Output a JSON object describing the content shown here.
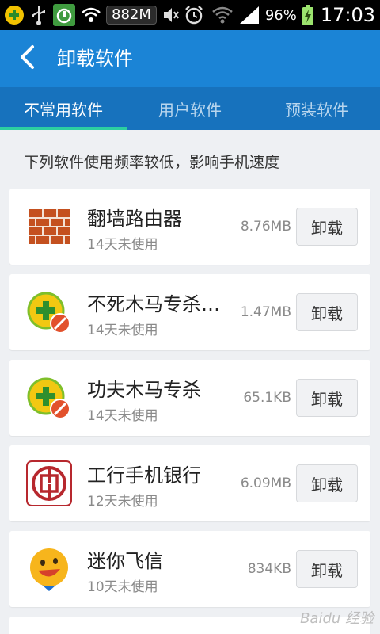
{
  "status_bar": {
    "net_speed": "882M",
    "battery_percent": "96%",
    "time": "17:03"
  },
  "appbar": {
    "title": "卸载软件"
  },
  "tabs": [
    {
      "label": "不常用软件",
      "active": true
    },
    {
      "label": "用户软件",
      "active": false
    },
    {
      "label": "预装软件",
      "active": false
    }
  ],
  "hint": "下列软件使用频率较低，影响手机速度",
  "apps": [
    {
      "name": "翻墙路由器",
      "usage": "14天未使用",
      "size": "8.76MB",
      "button": "卸载",
      "icon": "brick-wall-icon"
    },
    {
      "name": "不死木马专杀…",
      "usage": "14天未使用",
      "size": "1.47MB",
      "button": "卸载",
      "icon": "360-trojan-killer-icon"
    },
    {
      "name": "功夫木马专杀",
      "usage": "14天未使用",
      "size": "65.1KB",
      "button": "卸载",
      "icon": "360-trojan-killer-icon"
    },
    {
      "name": "工行手机银行",
      "usage": "12天未使用",
      "size": "6.09MB",
      "button": "卸载",
      "icon": "icbc-bank-icon"
    },
    {
      "name": "迷你飞信",
      "usage": "10天未使用",
      "size": "834KB",
      "button": "卸载",
      "icon": "fetion-smiley-icon"
    }
  ],
  "watermark": "Baidu 经验",
  "colors": {
    "appbar": "#1b84d6",
    "tabs": "#1772bd",
    "tab_indicator": "#2ccfa1",
    "background": "#eef0f3"
  }
}
